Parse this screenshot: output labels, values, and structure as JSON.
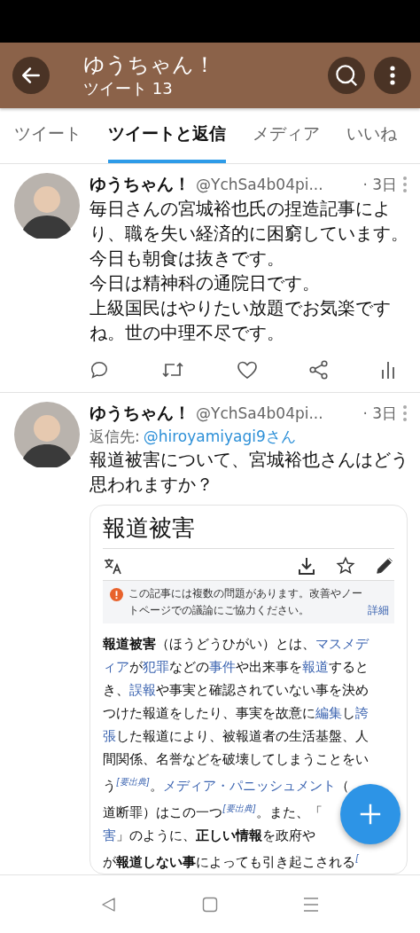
{
  "header": {
    "title": "ゆうちゃん！",
    "subtitle": "ツイート 13"
  },
  "tabs": [
    {
      "label": "ツイート",
      "selected": false
    },
    {
      "label": "ツイートと返信",
      "selected": true
    },
    {
      "label": "メディア",
      "selected": false
    },
    {
      "label": "いいね",
      "selected": false
    }
  ],
  "tweets": [
    {
      "name": "ゆうちゃん！",
      "handle": "@YchSa4b04pi...",
      "time": "· 3日",
      "text_lines": [
        "毎日さんの宮城裕也氏の捏造記事によ",
        "り、職を失い経済的に困窮しています。",
        "今日も朝食は抜きです。",
        "今日は精神科の通院日です。",
        "上級国民はやりたい放題でお気楽です",
        "ね。世の中理不尽です。"
      ]
    },
    {
      "name": "ゆうちゃん！",
      "handle": "@YchSa4b04pi...",
      "time": "· 3日",
      "reply_prefix": "返信先:",
      "reply_to": "@hiroyamiyagi9さん",
      "text_lines": [
        "報道被害について、宮城裕也さんはどう",
        "思われますか？"
      ],
      "card": {
        "title": "報道被害",
        "notice": {
          "text": "この記事には複数の問題があります。改善やノートページでの議論にご協力ください。",
          "link": "詳細"
        },
        "lines": [
          [
            {
              "kind": "bold",
              "text": "報道被害"
            },
            {
              "kind": "plain",
              "text": "（ほうどうひがい）とは、"
            },
            {
              "kind": "link",
              "text": "マスメデ"
            }
          ],
          [
            {
              "kind": "link",
              "text": "ィア"
            },
            {
              "kind": "plain",
              "text": "が"
            },
            {
              "kind": "link",
              "text": "犯罪"
            },
            {
              "kind": "plain",
              "text": "などの"
            },
            {
              "kind": "link",
              "text": "事件"
            },
            {
              "kind": "plain",
              "text": "や出来事を"
            },
            {
              "kind": "link",
              "text": "報道"
            },
            {
              "kind": "plain",
              "text": "すると"
            }
          ],
          [
            {
              "kind": "plain",
              "text": "き、"
            },
            {
              "kind": "link",
              "text": "誤報"
            },
            {
              "kind": "plain",
              "text": "や事実と確認されていない事を決め"
            }
          ],
          [
            {
              "kind": "plain",
              "text": "つけた報道をしたり、事実を故意に"
            },
            {
              "kind": "link",
              "text": "編集"
            },
            {
              "kind": "plain",
              "text": "し"
            },
            {
              "kind": "link",
              "text": "誇"
            }
          ],
          [
            {
              "kind": "link",
              "text": "張"
            },
            {
              "kind": "plain",
              "text": "した報道により、被報道者の生活基盤、人"
            }
          ],
          [
            {
              "kind": "plain",
              "text": "間関係、名誉などを破壊してしまうことをい"
            }
          ],
          [
            {
              "kind": "plain",
              "text": "う"
            },
            {
              "kind": "sup",
              "text": "[要出典]"
            },
            {
              "kind": "plain",
              "text": "。"
            },
            {
              "kind": "link",
              "text": "メディア・パニッシュメント"
            },
            {
              "kind": "plain",
              "text": "（"
            }
          ],
          [
            {
              "kind": "plain",
              "text": "道断罪）はこの一つ"
            },
            {
              "kind": "sup",
              "text": "[要出典]"
            },
            {
              "kind": "plain",
              "text": "。また、「"
            }
          ],
          [
            {
              "kind": "link",
              "text": "害"
            },
            {
              "kind": "plain",
              "text": "」のように、"
            },
            {
              "kind": "bold",
              "text": "正しい情報"
            },
            {
              "kind": "plain",
              "text": "を政府や"
            }
          ],
          [
            {
              "kind": "plain",
              "text": "が"
            },
            {
              "kind": "bold",
              "text": "報道しない事"
            },
            {
              "kind": "plain",
              "text": "によっても引き起こされる"
            },
            {
              "kind": "sup",
              "text": "["
            }
          ]
        ]
      }
    }
  ]
}
